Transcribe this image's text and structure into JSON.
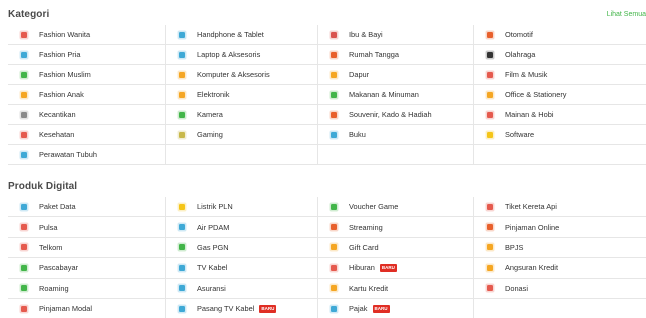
{
  "kategori": {
    "title": "Kategori",
    "see_all": "Lihat Semua",
    "items": [
      {
        "label": "Fashion Wanita",
        "icon": "dress-icon",
        "color": "#e55a4e"
      },
      {
        "label": "Handphone & Tablet",
        "icon": "tablet-icon",
        "color": "#3fa9d6"
      },
      {
        "label": "Ibu & Bayi",
        "icon": "stroller-icon",
        "color": "#d9534f"
      },
      {
        "label": "Otomotif",
        "icon": "steering-wheel-icon",
        "color": "#e8602c"
      },
      {
        "label": "Fashion Pria",
        "icon": "shirt-icon",
        "color": "#3fa9d6"
      },
      {
        "label": "Laptop & Aksesoris",
        "icon": "laptop-icon",
        "color": "#3fa9d6"
      },
      {
        "label": "Rumah Tangga",
        "icon": "sofa-icon",
        "color": "#e8602c"
      },
      {
        "label": "Olahraga",
        "icon": "ball-icon",
        "color": "#333333"
      },
      {
        "label": "Fashion Muslim",
        "icon": "hijab-icon",
        "color": "#42b549"
      },
      {
        "label": "Komputer & Aksesoris",
        "icon": "monitor-icon",
        "color": "#f5a623"
      },
      {
        "label": "Dapur",
        "icon": "chef-hat-icon",
        "color": "#f5a623"
      },
      {
        "label": "Film & Musik",
        "icon": "film-icon",
        "color": "#e55a4e"
      },
      {
        "label": "Fashion Anak",
        "icon": "kid-shirt-icon",
        "color": "#f5a623"
      },
      {
        "label": "Elektronik",
        "icon": "tv-icon",
        "color": "#f5a623"
      },
      {
        "label": "Makanan & Minuman",
        "icon": "bowl-icon",
        "color": "#42b549"
      },
      {
        "label": "Office & Stationery",
        "icon": "pencil-cup-icon",
        "color": "#f5a623"
      },
      {
        "label": "Kecantikan",
        "icon": "cosmetics-icon",
        "color": "#8a8a8a"
      },
      {
        "label": "Kamera",
        "icon": "camera-icon",
        "color": "#42b549"
      },
      {
        "label": "Souvenir, Kado & Hadiah",
        "icon": "gift-icon",
        "color": "#e8602c"
      },
      {
        "label": "Mainan & Hobi",
        "icon": "toy-icon",
        "color": "#e55a4e"
      },
      {
        "label": "Kesehatan",
        "icon": "first-aid-icon",
        "color": "#e55a4e"
      },
      {
        "label": "Gaming",
        "icon": "gamepad-icon",
        "color": "#c8b84a"
      },
      {
        "label": "Buku",
        "icon": "book-icon",
        "color": "#3fa9d6"
      },
      {
        "label": "Software",
        "icon": "software-icon",
        "color": "#f5c518"
      },
      {
        "label": "Perawatan Tubuh",
        "icon": "body-care-icon",
        "color": "#3fa9d6"
      }
    ]
  },
  "digital": {
    "title": "Produk Digital",
    "items": [
      {
        "label": "Paket Data",
        "icon": "wifi-icon",
        "color": "#3fa9d6",
        "badge": ""
      },
      {
        "label": "Listrik PLN",
        "icon": "bulb-icon",
        "color": "#f5c518",
        "badge": ""
      },
      {
        "label": "Voucher Game",
        "icon": "gamepad-icon",
        "color": "#42b549",
        "badge": ""
      },
      {
        "label": "Tiket Kereta Api",
        "icon": "train-icon",
        "color": "#e55a4e",
        "badge": ""
      },
      {
        "label": "Pulsa",
        "icon": "phone-icon",
        "color": "#e55a4e",
        "badge": ""
      },
      {
        "label": "Air PDAM",
        "icon": "drop-icon",
        "color": "#3fa9d6",
        "badge": ""
      },
      {
        "label": "Streaming",
        "icon": "play-icon",
        "color": "#e8602c",
        "badge": ""
      },
      {
        "label": "Pinjaman Online",
        "icon": "money-hand-icon",
        "color": "#e8602c",
        "badge": ""
      },
      {
        "label": "Telkom",
        "icon": "telephone-icon",
        "color": "#e55a4e",
        "badge": ""
      },
      {
        "label": "Gas PGN",
        "icon": "gas-icon",
        "color": "#42b549",
        "badge": ""
      },
      {
        "label": "Gift Card",
        "icon": "gift-card-icon",
        "color": "#f5a623",
        "badge": ""
      },
      {
        "label": "BPJS",
        "icon": "handshake-icon",
        "color": "#f5a623",
        "badge": ""
      },
      {
        "label": "Pascabayar",
        "icon": "bill-icon",
        "color": "#42b549",
        "badge": ""
      },
      {
        "label": "TV Kabel",
        "icon": "satellite-icon",
        "color": "#3fa9d6",
        "badge": ""
      },
      {
        "label": "Hiburan",
        "icon": "ticket-icon",
        "color": "#e55a4e",
        "badge": "BARU"
      },
      {
        "label": "Angsuran Kredit",
        "icon": "coin-icon",
        "color": "#f5a623",
        "badge": ""
      },
      {
        "label": "Roaming",
        "icon": "globe-icon",
        "color": "#42b549",
        "badge": ""
      },
      {
        "label": "Asuransi",
        "icon": "umbrella-icon",
        "color": "#3fa9d6",
        "badge": ""
      },
      {
        "label": "Kartu Kredit",
        "icon": "credit-card-icon",
        "color": "#f5a623",
        "badge": ""
      },
      {
        "label": "Donasi",
        "icon": "heart-hand-icon",
        "color": "#e55a4e",
        "badge": ""
      },
      {
        "label": "Pinjaman Modal",
        "icon": "store-icon",
        "color": "#e55a4e",
        "badge": ""
      },
      {
        "label": "Pasang TV Kabel",
        "icon": "tv-install-icon",
        "color": "#3fa9d6",
        "badge": "BARU"
      },
      {
        "label": "Pajak",
        "icon": "tax-icon",
        "color": "#3fa9d6",
        "badge": "BARU"
      }
    ]
  }
}
